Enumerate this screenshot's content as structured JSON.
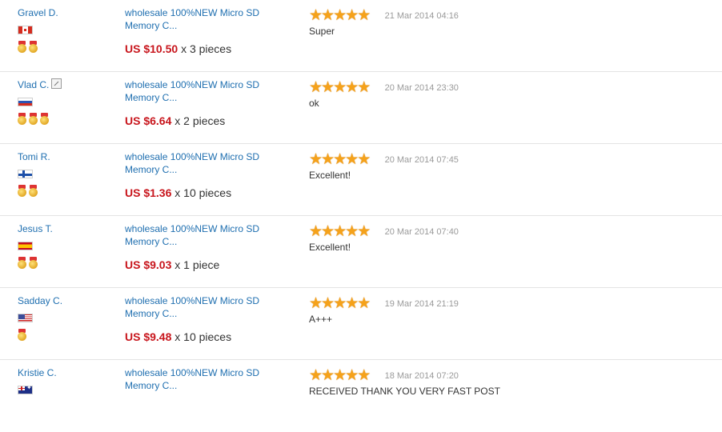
{
  "feedback": [
    {
      "buyer": "Gravel D.",
      "edit": false,
      "flag": "canada-flag",
      "medals": 2,
      "product": "wholesale 100%NEW Micro SD Memory C...",
      "price": "US $10.50",
      "qty": "x 3 pieces",
      "rating": 5,
      "date": "21 Mar 2014 04:16",
      "comment": "Super"
    },
    {
      "buyer": "Vlad C.",
      "edit": true,
      "flag": "russia-flag",
      "medals": 3,
      "product": "wholesale 100%NEW Micro SD Memory C...",
      "price": "US $6.64",
      "qty": "x 2 pieces",
      "rating": 5,
      "date": "20 Mar 2014 23:30",
      "comment": "ok"
    },
    {
      "buyer": "Tomi R.",
      "edit": false,
      "flag": "finland-flag",
      "medals": 2,
      "product": "wholesale 100%NEW Micro SD Memory C...",
      "price": "US $1.36",
      "qty": "x 10 pieces",
      "rating": 5,
      "date": "20 Mar 2014 07:45",
      "comment": "Excellent!"
    },
    {
      "buyer": "Jesus T.",
      "edit": false,
      "flag": "spain-flag",
      "medals": 2,
      "product": "wholesale 100%NEW Micro SD Memory C...",
      "price": "US $9.03",
      "qty": "x 1 piece",
      "rating": 5,
      "date": "20 Mar 2014 07:40",
      "comment": "Excellent!"
    },
    {
      "buyer": "Sadday C.",
      "edit": false,
      "flag": "usa-flag",
      "medals": 1,
      "product": "wholesale 100%NEW Micro SD Memory C...",
      "price": "US $9.48",
      "qty": "x 10 pieces",
      "rating": 5,
      "date": "19 Mar 2014 21:19",
      "comment": "A+++"
    },
    {
      "buyer": "Kristie C.",
      "edit": false,
      "flag": "australia-flag",
      "medals": 0,
      "product": "wholesale 100%NEW Micro SD Memory C...",
      "price": "",
      "qty": "",
      "rating": 5,
      "date": "18 Mar 2014 07:20",
      "comment": "RECEIVED THANK YOU VERY FAST POST"
    }
  ],
  "colors": {
    "link": "#1f6fb0",
    "price": "#c8161d",
    "star": "#f5a21b",
    "date": "#9a9a9a",
    "divider": "#e3e3e3"
  }
}
